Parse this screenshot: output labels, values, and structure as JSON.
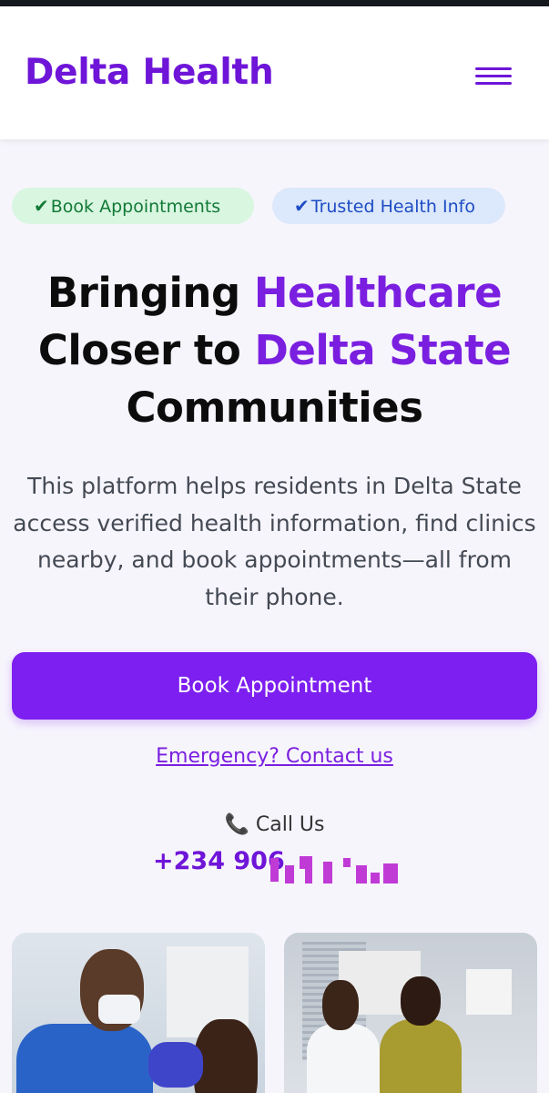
{
  "header": {
    "brand": "Delta Health",
    "menu_icon": "hamburger-menu-icon"
  },
  "badges": [
    {
      "check": "✔",
      "label": "Book Appointments"
    },
    {
      "check": "✔",
      "label": "Trusted Health Info"
    }
  ],
  "hero": {
    "title_part1": "Bringing ",
    "title_accent1": "Healthcare",
    "title_part2": "Closer to ",
    "title_accent2": "Delta State",
    "title_part3": "Communities",
    "description": "This platform helps residents in Delta State access verified health information, find clinics nearby, and book appointments—all from their phone."
  },
  "actions": {
    "book_label": "Book Appointment",
    "emergency_label": "Emergency? Contact us",
    "call_label": "📞 Call Us",
    "phone_visible": "+234 906"
  },
  "colors": {
    "brand": "#6e15d8",
    "cta": "#7d1ff0",
    "badge_green_bg": "#d9f6e1",
    "badge_blue_bg": "#dce8fb"
  }
}
